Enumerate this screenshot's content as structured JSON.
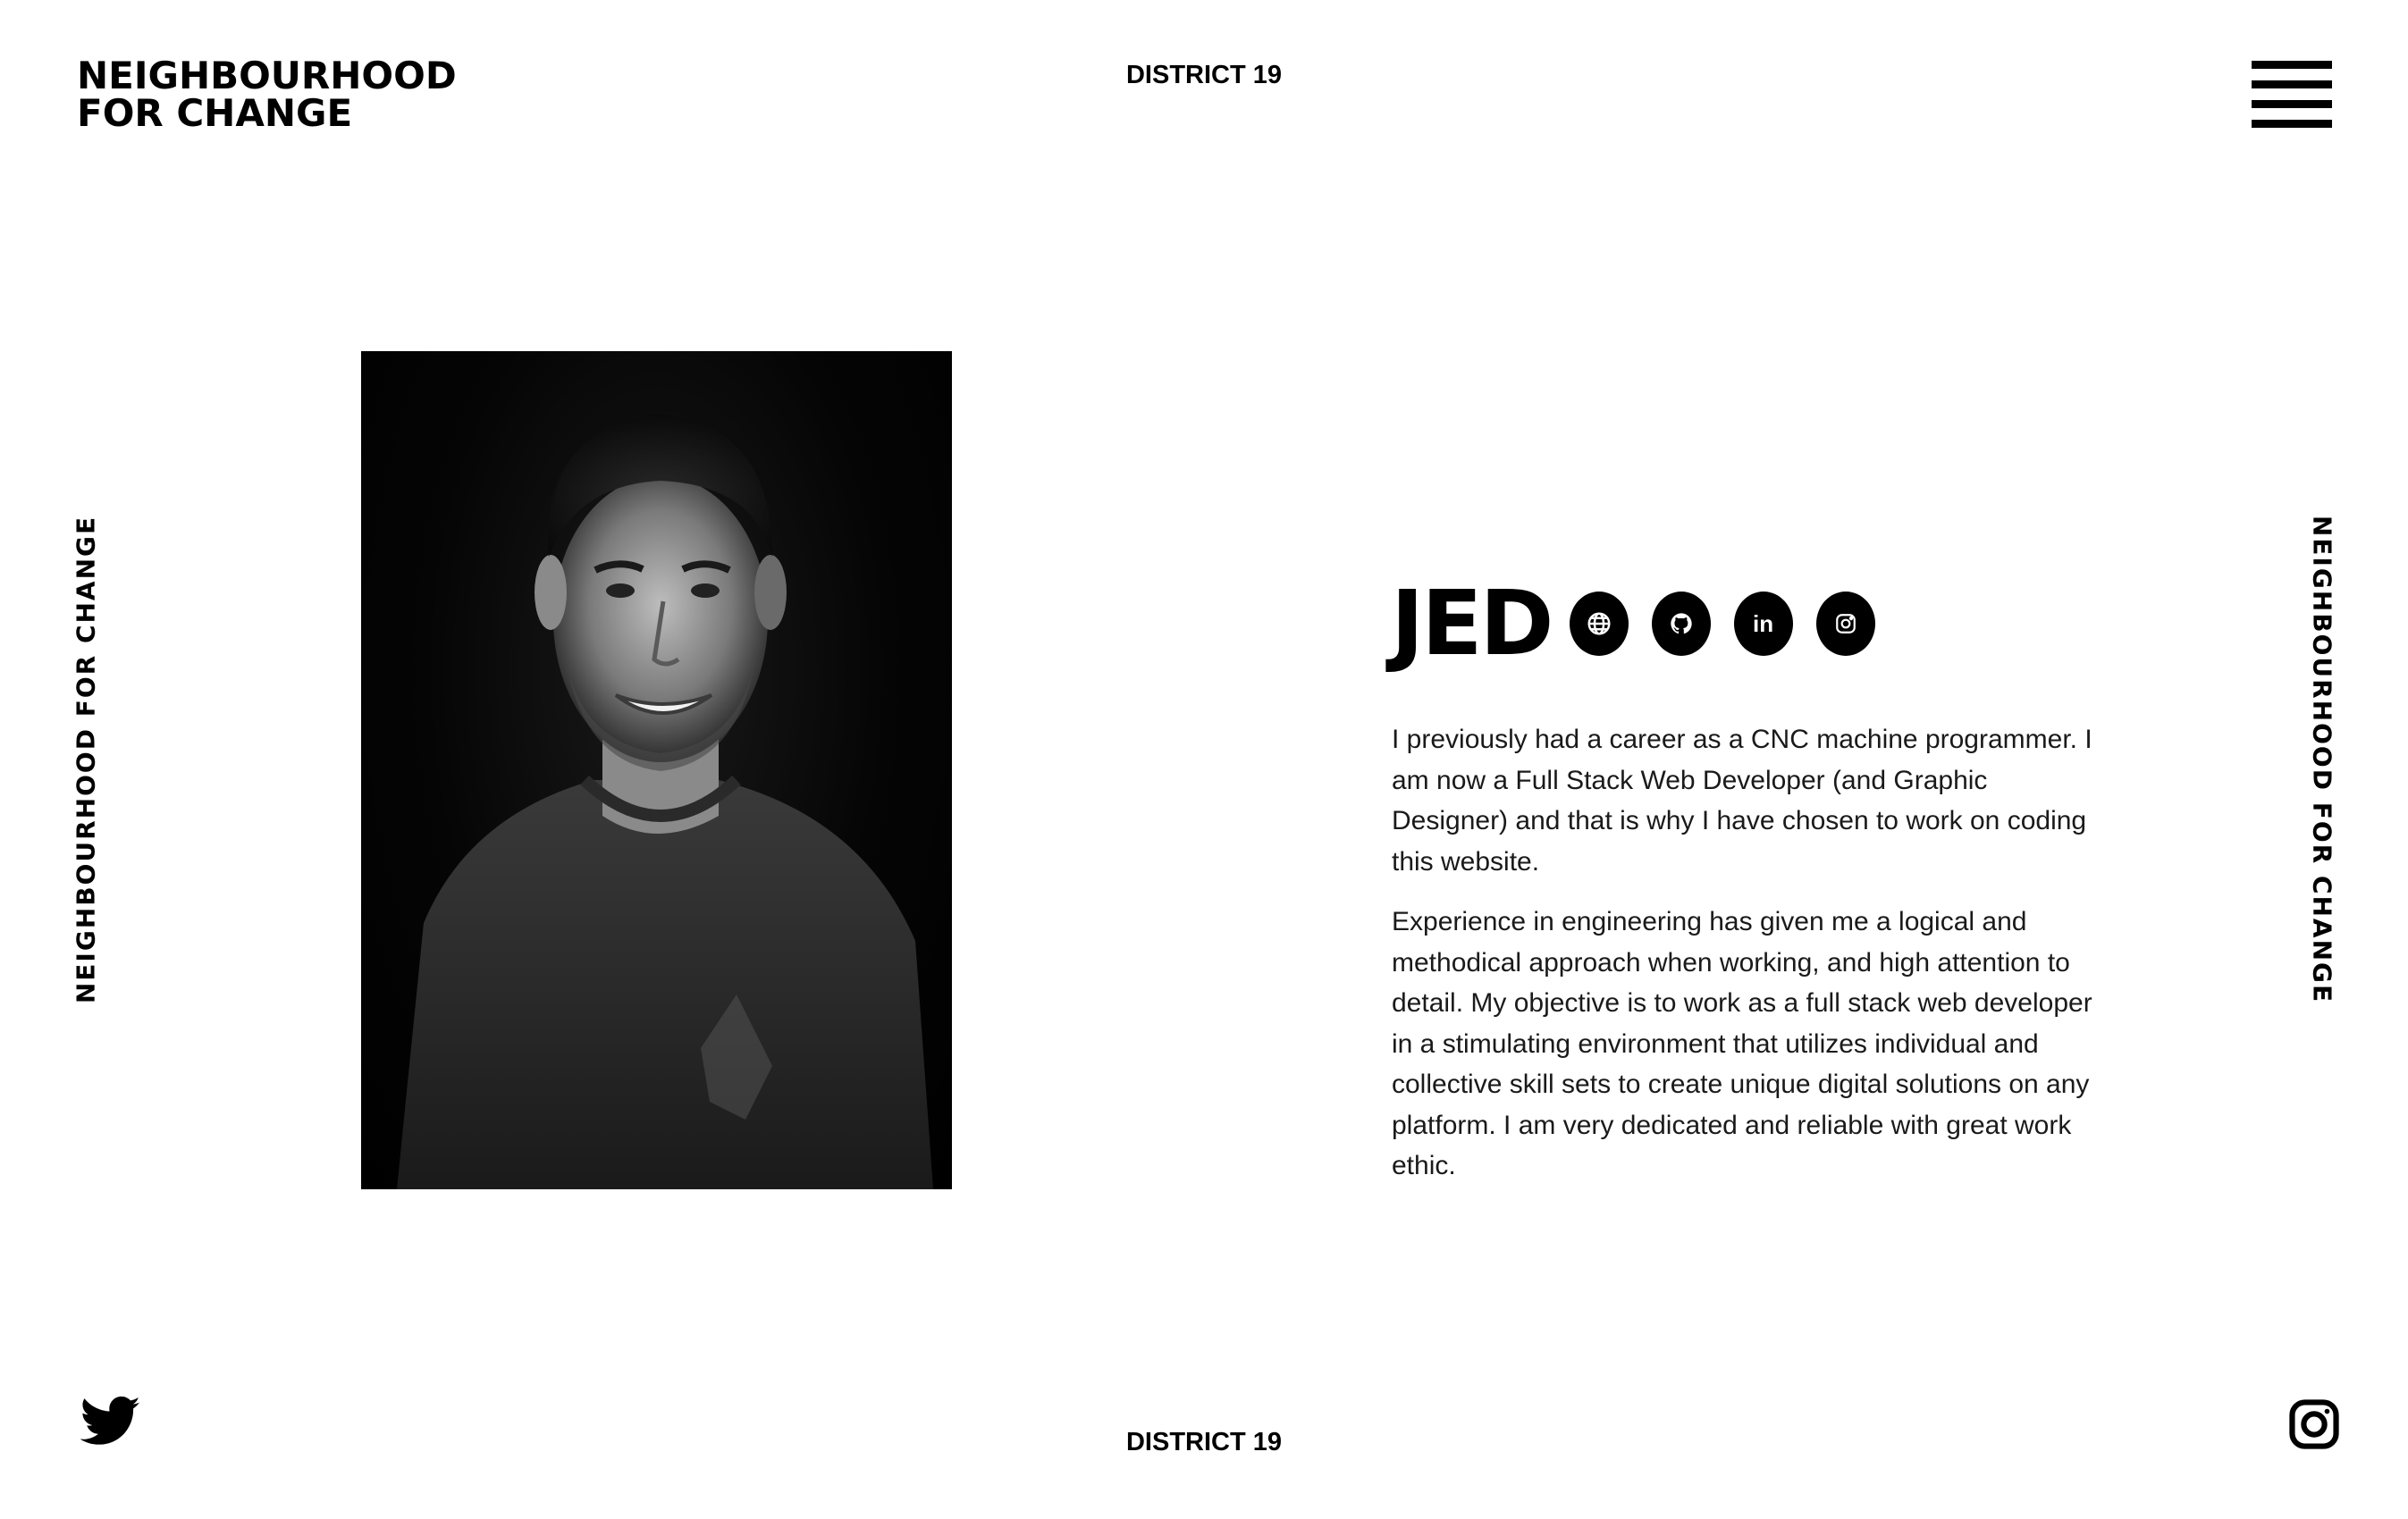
{
  "header": {
    "logo_line1": "NEIGHBOURHOOD",
    "logo_line2": "FOR CHANGE",
    "district": "DISTRICT 19",
    "menu_icon": "hamburger-menu-icon"
  },
  "sidebar": {
    "left_label": "NEIGHBOURHOOD FOR CHANGE",
    "right_label": "NEIGHBOURHOOD FOR CHANGE"
  },
  "profile": {
    "photo_alt": "portrait-photo",
    "name": "JED",
    "social_links": [
      {
        "icon": "globe-icon"
      },
      {
        "icon": "github-icon"
      },
      {
        "icon": "linkedin-icon",
        "label": "in"
      },
      {
        "icon": "instagram-icon"
      }
    ],
    "bio": [
      "I previously had a career as a CNC machine programmer. I am now a Full Stack Web Developer (and Graphic Designer) and that is why I have chosen to work on coding this website.",
      "Experience in engineering has given me a logical and methodical approach when working, and high attention to detail. My objective is to work as a full stack web developer in a stimulating environment that utilizes individual and collective skill sets to create unique digital solutions on any platform. I am very dedicated and reliable with great work ethic."
    ]
  },
  "footer": {
    "district": "DISTRICT 19",
    "twitter_icon": "twitter-icon",
    "instagram_icon": "instagram-icon"
  },
  "colors": {
    "background": "#ffffff",
    "text": "#000000",
    "body_text": "#1a1a1a"
  }
}
